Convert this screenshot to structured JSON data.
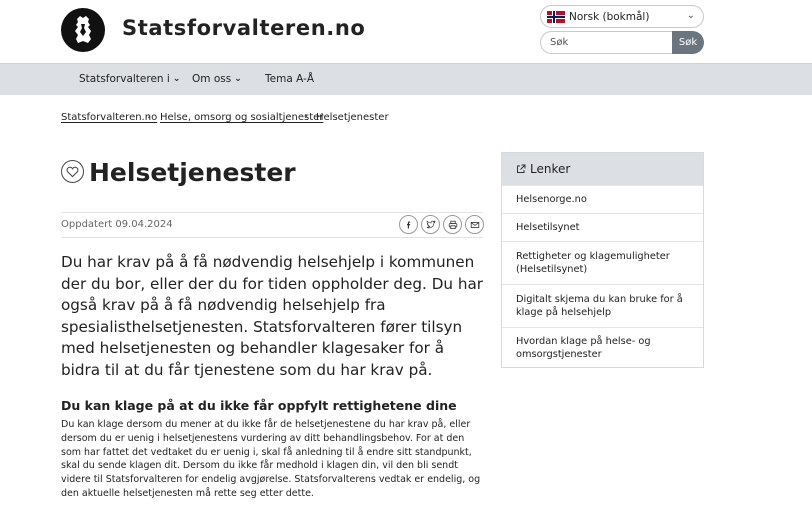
{
  "header": {
    "site_title": "Statsforvalteren.no",
    "language": "Norsk (bokmål)",
    "search_placeholder": "Søk",
    "search_button": "Søk"
  },
  "nav": {
    "items": [
      {
        "label": "Statsforvalteren i"
      },
      {
        "label": "Om oss"
      },
      {
        "label": "Tema A-Å"
      }
    ]
  },
  "breadcrumb": {
    "items": [
      "Statsforvalteren.no",
      "Helse, omsorg og sosialtjenester",
      "Helsetjenester"
    ]
  },
  "page": {
    "title": "Helsetjenester",
    "updated": "Oppdatert 09.04.2024",
    "lead": "Du har krav på å få nødvendig helsehjelp i kommunen der du bor, eller der du for tiden oppholder deg. Du har også krav på å få nødvendig helsehjelp fra spesialisthelsetjenesten. Statsforvalteren fører tilsyn med helsetjenesten og behandler klagesaker for å bidra til at du får tjenestene som du har krav på.",
    "section_heading": "Du kan klage på at du ikke får oppfylt rettighetene dine",
    "section_body": "Du kan klage dersom du mener at du ikke får de helsetjenestene du har krav på, eller dersom du er uenig i helsetjenestens vurdering av ditt behandlingsbehov. For at den som har fattet det vedtaket du er uenig i, skal få anledning til å endre sitt standpunkt, skal du sende klagen dit. Dersom du ikke får medhold i klagen din, vil den bli sendt videre til Statsforvalteren for endelig avgjørelse. Statsforvalterens vedtak er endelig, og den aktuelle helsetjenesten må rette seg etter dette."
  },
  "sidebar": {
    "title": "Lenker",
    "links": [
      {
        "label": "Helsenorge.no"
      },
      {
        "label": "Helsetilsynet"
      },
      {
        "label": "Rettigheter og klagemuligheter (Helsetilsynet)"
      },
      {
        "label": "Digitalt skjema du kan bruke for å klage på helsehjelp"
      },
      {
        "label": "Hvordan klage på helse- og omsorgstjenester"
      }
    ]
  },
  "icons": {
    "logo": "coat-of-arms-lion-icon",
    "flag": "norway-flag-icon",
    "favorite": "heart-icon",
    "share": [
      "facebook-icon",
      "twitter-icon",
      "print-icon",
      "mail-icon"
    ],
    "external_link": "external-link-icon"
  },
  "colors": {
    "nav_bg": "#dcdfe3",
    "search_button_bg": "#6b7580",
    "flag_red": "#ba0c2f",
    "flag_blue": "#00205b"
  }
}
